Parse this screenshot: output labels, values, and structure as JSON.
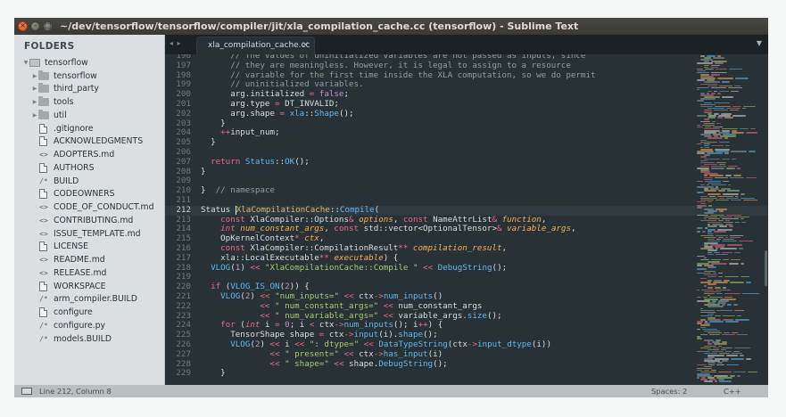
{
  "window": {
    "title": "~/dev/tensorflow/tensorflow/compiler/jit/xla_compilation_cache.cc (tensorflow) - Sublime Text",
    "controls": [
      "×",
      "–",
      "□"
    ]
  },
  "sidebar": {
    "header": "FOLDERS",
    "root": "tensorflow",
    "items": [
      {
        "label": "tensorflow",
        "kind": "folder"
      },
      {
        "label": "third_party",
        "kind": "folder"
      },
      {
        "label": "tools",
        "kind": "folder"
      },
      {
        "label": "util",
        "kind": "folder"
      },
      {
        "label": ".gitignore",
        "kind": "file"
      },
      {
        "label": "ACKNOWLEDGMENTS",
        "kind": "file"
      },
      {
        "label": "ADOPTERS.md",
        "kind": "code"
      },
      {
        "label": "AUTHORS",
        "kind": "file"
      },
      {
        "label": "BUILD",
        "kind": "slash"
      },
      {
        "label": "CODEOWNERS",
        "kind": "file"
      },
      {
        "label": "CODE_OF_CONDUCT.md",
        "kind": "code"
      },
      {
        "label": "CONTRIBUTING.md",
        "kind": "code"
      },
      {
        "label": "ISSUE_TEMPLATE.md",
        "kind": "code"
      },
      {
        "label": "LICENSE",
        "kind": "file"
      },
      {
        "label": "README.md",
        "kind": "code"
      },
      {
        "label": "RELEASE.md",
        "kind": "code"
      },
      {
        "label": "WORKSPACE",
        "kind": "file"
      },
      {
        "label": "arm_compiler.BUILD",
        "kind": "slash"
      },
      {
        "label": "configure",
        "kind": "file"
      },
      {
        "label": "configure.py",
        "kind": "slash"
      },
      {
        "label": "models.BUILD",
        "kind": "slash"
      }
    ]
  },
  "tabs": {
    "nav": "◂ ▸",
    "active_label": "xla_compilation_cache.cc",
    "close": "×",
    "dropdown": "▼"
  },
  "editor": {
    "active_line": 212,
    "lines": [
      {
        "n": "196",
        "tokens": [
          [
            "pl",
            "      "
          ],
          [
            "cm",
            "// The values of uninitialized variables are not passed as inputs, since"
          ]
        ]
      },
      {
        "n": "197",
        "tokens": [
          [
            "pl",
            "      "
          ],
          [
            "cm",
            "// they are meaningless. However, it is legal to assign to a resource"
          ]
        ]
      },
      {
        "n": "198",
        "tokens": [
          [
            "pl",
            "      "
          ],
          [
            "cm",
            "// variable for the first time inside the XLA computation, so we do permit"
          ]
        ]
      },
      {
        "n": "199",
        "tokens": [
          [
            "pl",
            "      "
          ],
          [
            "cm",
            "// uninitialized variables."
          ]
        ]
      },
      {
        "n": "200",
        "tokens": [
          [
            "pl",
            "      arg.initialized "
          ],
          [
            "op",
            "="
          ],
          [
            "pl",
            " "
          ],
          [
            "con",
            "false"
          ],
          [
            "pl",
            ";"
          ]
        ]
      },
      {
        "n": "201",
        "tokens": [
          [
            "pl",
            "      arg.type "
          ],
          [
            "op",
            "="
          ],
          [
            "pl",
            " DT_INVALID;"
          ]
        ]
      },
      {
        "n": "202",
        "tokens": [
          [
            "pl",
            "      arg.shape "
          ],
          [
            "op",
            "="
          ],
          [
            "pl",
            " "
          ],
          [
            "fn",
            "xla"
          ],
          [
            "pl",
            "::"
          ],
          [
            "fn",
            "Shape"
          ],
          [
            "pl",
            "();"
          ]
        ]
      },
      {
        "n": "203",
        "tokens": [
          [
            "pl",
            "    }"
          ]
        ]
      },
      {
        "n": "204",
        "tokens": [
          [
            "pl",
            "    "
          ],
          [
            "op",
            "++"
          ],
          [
            "pl",
            "input_num;"
          ]
        ]
      },
      {
        "n": "205",
        "tokens": [
          [
            "pl",
            "  }"
          ]
        ]
      },
      {
        "n": "206",
        "tokens": [
          [
            "pl",
            ""
          ]
        ]
      },
      {
        "n": "207",
        "tokens": [
          [
            "pl",
            "  "
          ],
          [
            "kw",
            "return"
          ],
          [
            "pl",
            " "
          ],
          [
            "fn",
            "Status"
          ],
          [
            "pl",
            "::"
          ],
          [
            "fn",
            "OK"
          ],
          [
            "pl",
            "();"
          ]
        ]
      },
      {
        "n": "208",
        "tokens": [
          [
            "pl",
            "}"
          ]
        ]
      },
      {
        "n": "209",
        "tokens": [
          [
            "pl",
            ""
          ]
        ]
      },
      {
        "n": "210",
        "tokens": [
          [
            "pl",
            "}  "
          ],
          [
            "cm",
            "// namespace"
          ]
        ]
      },
      {
        "n": "211",
        "tokens": [
          [
            "pl",
            ""
          ]
        ]
      },
      {
        "n": "212",
        "tokens": [
          [
            "pl",
            "Status "
          ],
          [
            "cursor",
            ""
          ],
          [
            "cls",
            "XlaCompilationCache"
          ],
          [
            "pl",
            "::"
          ],
          [
            "fn",
            "Compile"
          ],
          [
            "pl",
            "("
          ]
        ]
      },
      {
        "n": "213",
        "tokens": [
          [
            "pl",
            "    "
          ],
          [
            "kw",
            "const"
          ],
          [
            "pl",
            " XlaCompiler::Options"
          ],
          [
            "op",
            "&"
          ],
          [
            "pl",
            " "
          ],
          [
            "par",
            "options"
          ],
          [
            "pl",
            ", "
          ],
          [
            "kw",
            "const"
          ],
          [
            "pl",
            " NameAttrList"
          ],
          [
            "op",
            "&"
          ],
          [
            "pl",
            " "
          ],
          [
            "par",
            "function"
          ],
          [
            "pl",
            ","
          ]
        ]
      },
      {
        "n": "214",
        "tokens": [
          [
            "pl",
            "    "
          ],
          [
            "ty",
            "int"
          ],
          [
            "pl",
            " "
          ],
          [
            "par",
            "num_constant_args"
          ],
          [
            "pl",
            ", "
          ],
          [
            "kw",
            "const"
          ],
          [
            "pl",
            " std::vector<OptionalTensor>"
          ],
          [
            "op",
            "&"
          ],
          [
            "pl",
            " "
          ],
          [
            "par",
            "variable_args"
          ],
          [
            "pl",
            ","
          ]
        ]
      },
      {
        "n": "215",
        "tokens": [
          [
            "pl",
            "    OpKernelContext"
          ],
          [
            "op",
            "*"
          ],
          [
            "pl",
            " "
          ],
          [
            "par",
            "ctx"
          ],
          [
            "pl",
            ","
          ]
        ]
      },
      {
        "n": "216",
        "tokens": [
          [
            "pl",
            "    "
          ],
          [
            "kw",
            "const"
          ],
          [
            "pl",
            " XlaCompiler::CompilationResult"
          ],
          [
            "op",
            "**"
          ],
          [
            "pl",
            " "
          ],
          [
            "par",
            "compilation_result"
          ],
          [
            "pl",
            ","
          ]
        ]
      },
      {
        "n": "217",
        "tokens": [
          [
            "pl",
            "    xla::LocalExecutable"
          ],
          [
            "op",
            "**"
          ],
          [
            "pl",
            " "
          ],
          [
            "par",
            "executable"
          ],
          [
            "pl",
            ") {"
          ]
        ]
      },
      {
        "n": "218",
        "tokens": [
          [
            "pl",
            "  "
          ],
          [
            "fn",
            "VLOG"
          ],
          [
            "pl",
            "("
          ],
          [
            "num",
            "1"
          ],
          [
            "pl",
            ") "
          ],
          [
            "op",
            "<<"
          ],
          [
            "pl",
            " "
          ],
          [
            "str",
            "\"XlaCompilationCache::Compile \""
          ],
          [
            "pl",
            " "
          ],
          [
            "op",
            "<<"
          ],
          [
            "pl",
            " "
          ],
          [
            "fn",
            "DebugString"
          ],
          [
            "pl",
            "();"
          ]
        ]
      },
      {
        "n": "219",
        "tokens": [
          [
            "pl",
            ""
          ]
        ]
      },
      {
        "n": "220",
        "tokens": [
          [
            "pl",
            "  "
          ],
          [
            "kw",
            "if"
          ],
          [
            "pl",
            " ("
          ],
          [
            "fn",
            "VLOG_IS_ON"
          ],
          [
            "pl",
            "("
          ],
          [
            "num",
            "2"
          ],
          [
            "pl",
            ")) {"
          ]
        ]
      },
      {
        "n": "221",
        "tokens": [
          [
            "pl",
            "    "
          ],
          [
            "fn",
            "VLOG"
          ],
          [
            "pl",
            "("
          ],
          [
            "num",
            "2"
          ],
          [
            "pl",
            ") "
          ],
          [
            "op",
            "<<"
          ],
          [
            "pl",
            " "
          ],
          [
            "str",
            "\"num_inputs=\""
          ],
          [
            "pl",
            " "
          ],
          [
            "op",
            "<<"
          ],
          [
            "pl",
            " ctx"
          ],
          [
            "op",
            "->"
          ],
          [
            "fn",
            "num_inputs"
          ],
          [
            "pl",
            "()"
          ]
        ]
      },
      {
        "n": "222",
        "tokens": [
          [
            "pl",
            "            "
          ],
          [
            "op",
            "<<"
          ],
          [
            "pl",
            " "
          ],
          [
            "str",
            "\" num_constant_args=\""
          ],
          [
            "pl",
            " "
          ],
          [
            "op",
            "<<"
          ],
          [
            "pl",
            " num_constant_args"
          ]
        ]
      },
      {
        "n": "223",
        "tokens": [
          [
            "pl",
            "            "
          ],
          [
            "op",
            "<<"
          ],
          [
            "pl",
            " "
          ],
          [
            "str",
            "\" num_variable_args=\""
          ],
          [
            "pl",
            " "
          ],
          [
            "op",
            "<<"
          ],
          [
            "pl",
            " variable_args."
          ],
          [
            "fn",
            "size"
          ],
          [
            "pl",
            "();"
          ]
        ]
      },
      {
        "n": "224",
        "tokens": [
          [
            "pl",
            "    "
          ],
          [
            "kw",
            "for"
          ],
          [
            "pl",
            " ("
          ],
          [
            "ty",
            "int"
          ],
          [
            "pl",
            " i "
          ],
          [
            "op",
            "="
          ],
          [
            "pl",
            " "
          ],
          [
            "num",
            "0"
          ],
          [
            "pl",
            "; i "
          ],
          [
            "op",
            "<"
          ],
          [
            "pl",
            " ctx"
          ],
          [
            "op",
            "->"
          ],
          [
            "fn",
            "num_inputs"
          ],
          [
            "pl",
            "(); i"
          ],
          [
            "op",
            "++"
          ],
          [
            "pl",
            ") {"
          ]
        ]
      },
      {
        "n": "225",
        "tokens": [
          [
            "pl",
            "      TensorShape shape "
          ],
          [
            "op",
            "="
          ],
          [
            "pl",
            " ctx"
          ],
          [
            "op",
            "->"
          ],
          [
            "fn",
            "input"
          ],
          [
            "pl",
            "(i)."
          ],
          [
            "fn",
            "shape"
          ],
          [
            "pl",
            "();"
          ]
        ]
      },
      {
        "n": "226",
        "tokens": [
          [
            "pl",
            "      "
          ],
          [
            "fn",
            "VLOG"
          ],
          [
            "pl",
            "("
          ],
          [
            "num",
            "2"
          ],
          [
            "pl",
            ") "
          ],
          [
            "op",
            "<<"
          ],
          [
            "pl",
            " i "
          ],
          [
            "op",
            "<<"
          ],
          [
            "pl",
            " "
          ],
          [
            "str",
            "\": dtype=\""
          ],
          [
            "pl",
            " "
          ],
          [
            "op",
            "<<"
          ],
          [
            "pl",
            " "
          ],
          [
            "fn",
            "DataTypeString"
          ],
          [
            "pl",
            "(ctx"
          ],
          [
            "op",
            "->"
          ],
          [
            "fn",
            "input_dtype"
          ],
          [
            "pl",
            "(i))"
          ]
        ]
      },
      {
        "n": "227",
        "tokens": [
          [
            "pl",
            "              "
          ],
          [
            "op",
            "<<"
          ],
          [
            "pl",
            " "
          ],
          [
            "str",
            "\" present=\""
          ],
          [
            "pl",
            " "
          ],
          [
            "op",
            "<<"
          ],
          [
            "pl",
            " ctx"
          ],
          [
            "op",
            "->"
          ],
          [
            "fn",
            "has_input"
          ],
          [
            "pl",
            "(i)"
          ]
        ]
      },
      {
        "n": "228",
        "tokens": [
          [
            "pl",
            "              "
          ],
          [
            "op",
            "<<"
          ],
          [
            "pl",
            " "
          ],
          [
            "str",
            "\" shape=\""
          ],
          [
            "pl",
            " "
          ],
          [
            "op",
            "<<"
          ],
          [
            "pl",
            " shape."
          ],
          [
            "fn",
            "DebugString"
          ],
          [
            "pl",
            "();"
          ]
        ]
      },
      {
        "n": "229",
        "tokens": [
          [
            "pl",
            "    }"
          ]
        ]
      }
    ]
  },
  "statusbar": {
    "position": "Line 212, Column 8",
    "spaces": "Spaces: 2",
    "syntax": "C++"
  },
  "colors": {
    "editor_bg": "#273136",
    "comment": "#8f9ea4",
    "keyword": "#ec6a87",
    "function": "#61b8f0",
    "string": "#a6cc70",
    "number": "#c594c5",
    "parameter": "#f9ae58",
    "class": "#e0b56a"
  }
}
